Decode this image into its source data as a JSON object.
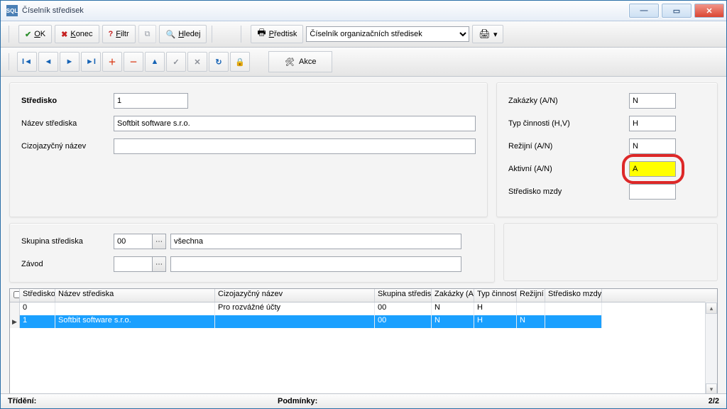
{
  "window": {
    "title": "Číselník středisek"
  },
  "toolbar": {
    "ok": "OK",
    "konec": "Konec",
    "filtr": "Filtr",
    "hledej": "Hledej",
    "predtisk": "Předtisk",
    "combo_value": "Číselník organizačních středisek"
  },
  "nav": {
    "akce": "Akce"
  },
  "form": {
    "stredisko_label": "Středisko",
    "stredisko_value": "1",
    "nazev_label": "Název střediska",
    "nazev_value": "Softbit software s.r.o.",
    "cizo_label": "Cizojazyčný název",
    "cizo_value": "",
    "skupina_label": "Skupina střediska",
    "skupina_code": "00",
    "skupina_text": "všechna",
    "zavod_label": "Závod",
    "zavod_code": "",
    "zavod_text": ""
  },
  "side": {
    "zak_label": "Zakázky (A/N)",
    "zak_value": "N",
    "typ_label": "Typ činnosti (H,V)",
    "typ_value": "H",
    "rez_label": "Režijní (A/N)",
    "rez_value": "N",
    "akt_label": "Aktivní (A/N)",
    "akt_value": "A",
    "mzdy_label": "Středisko mzdy",
    "mzdy_value": ""
  },
  "grid": {
    "headers": {
      "stredisko": "Středisko",
      "nazev": "Název střediska",
      "cizo": "Cizojazyčný název",
      "skup": "Skupina střediska",
      "zak": "Zakázky (A/N)",
      "typ": "Typ činnosti",
      "rez": "Režijní",
      "mzdy": "Středisko mzdy"
    },
    "rows": [
      {
        "sel": "",
        "stredisko": "0",
        "nazev": "",
        "cizo": "Pro rozvážné účty",
        "skup": "00",
        "zak": "N",
        "typ": "H",
        "rez": "",
        "mzdy": ""
      },
      {
        "sel": "▶",
        "stredisko": "1",
        "nazev": "Softbit software s.r.o.",
        "cizo": "",
        "skup": "00",
        "zak": "N",
        "typ": "H",
        "rez": "N",
        "mzdy": ""
      }
    ]
  },
  "status": {
    "trideni": "Třídění:",
    "podminky": "Podmínky:",
    "counter": "2/2"
  }
}
